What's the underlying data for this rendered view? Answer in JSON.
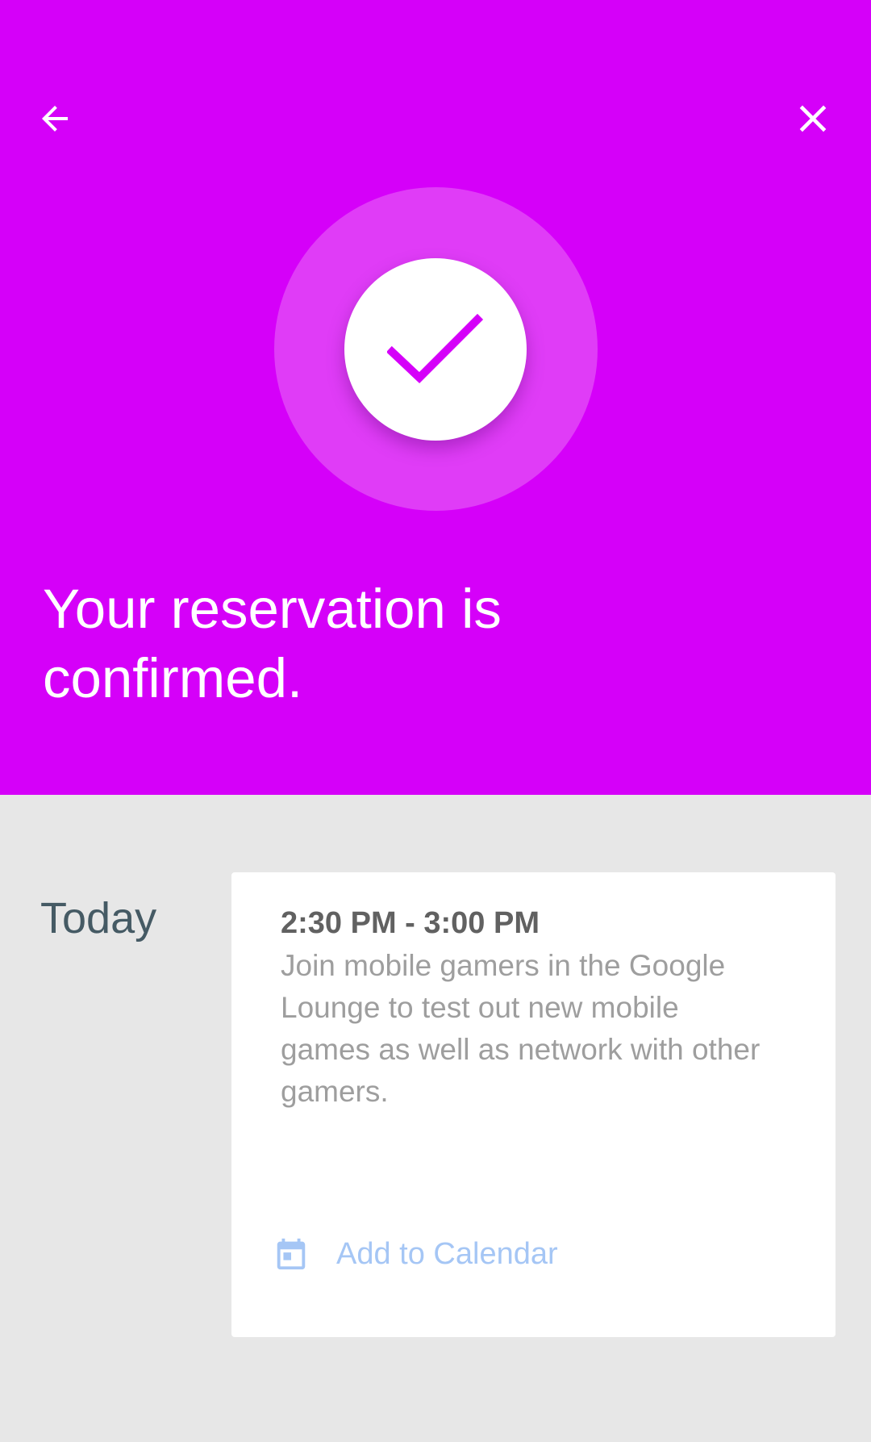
{
  "header": {
    "back_icon": "arrow-back-icon",
    "close_icon": "close-icon",
    "check_icon": "check-icon",
    "background_color": "#d500f9",
    "headline": "Your reservation is confirmed."
  },
  "schedule": {
    "day_label": "Today",
    "event": {
      "time": "2:30 PM - 3:00 PM",
      "description": "Join mobile gamers in the Google Lounge to test out new mobile games as well as network with other gamers.",
      "add_to_calendar_label": "Add to Calendar",
      "calendar_icon": "calendar-icon",
      "link_color": "#a5c6f5"
    }
  }
}
